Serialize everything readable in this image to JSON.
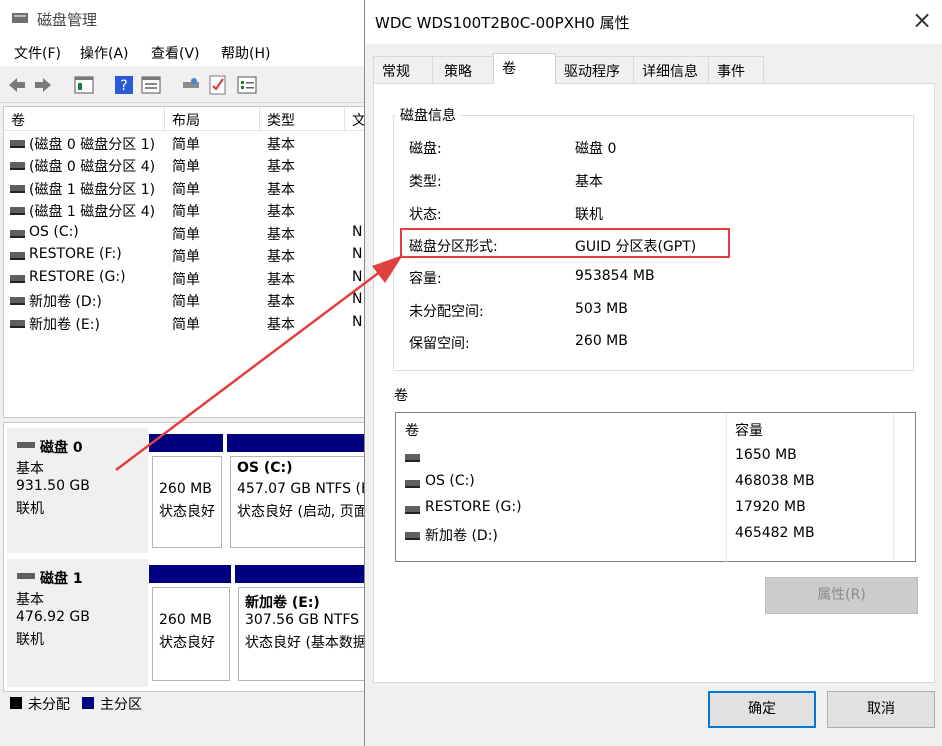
{
  "diskmgmt": {
    "title": "磁盘管理",
    "menu": [
      "文件(F)",
      "操作(A)",
      "查看(V)",
      "帮助(H)"
    ],
    "columns": [
      "卷",
      "布局",
      "类型",
      "文"
    ],
    "volumes": [
      {
        "name": "(磁盘 0 磁盘分区 1)",
        "layout": "简单",
        "type": "基本",
        "fs": ""
      },
      {
        "name": "(磁盘 0 磁盘分区 4)",
        "layout": "简单",
        "type": "基本",
        "fs": ""
      },
      {
        "name": "(磁盘 1 磁盘分区 1)",
        "layout": "简单",
        "type": "基本",
        "fs": ""
      },
      {
        "name": "(磁盘 1 磁盘分区 4)",
        "layout": "简单",
        "type": "基本",
        "fs": ""
      },
      {
        "name": "OS (C:)",
        "layout": "简单",
        "type": "基本",
        "fs": "N"
      },
      {
        "name": "RESTORE (F:)",
        "layout": "简单",
        "type": "基本",
        "fs": "N"
      },
      {
        "name": "RESTORE (G:)",
        "layout": "简单",
        "type": "基本",
        "fs": "N"
      },
      {
        "name": "新加卷 (D:)",
        "layout": "简单",
        "type": "基本",
        "fs": "N"
      },
      {
        "name": "新加卷 (E:)",
        "layout": "简单",
        "type": "基本",
        "fs": "N"
      }
    ],
    "disks": [
      {
        "name": "磁盘 0",
        "kind": "基本",
        "size": "931.50 GB",
        "status": "联机",
        "partitions": [
          {
            "title": "",
            "line1": "260 MB",
            "line2": "状态良好"
          },
          {
            "title": "OS  (C:)",
            "line1": "457.07 GB NTFS (B",
            "line2": "状态良好 (启动, 页面"
          }
        ]
      },
      {
        "name": "磁盘 1",
        "kind": "基本",
        "size": "476.92 GB",
        "status": "联机",
        "partitions": [
          {
            "title": "",
            "line1": "260 MB",
            "line2": "状态良好"
          },
          {
            "title": "新加卷  (E:)",
            "line1": "307.56 GB NTFS (",
            "line2": "状态良好 (基本数据"
          }
        ]
      }
    ],
    "legend": [
      {
        "label": "未分配",
        "color": "#000000"
      },
      {
        "label": "主分区",
        "color": "#000080"
      }
    ]
  },
  "dialog": {
    "title": "WDC WDS100T2B0C-00PXH0 属性",
    "tabs": [
      "常规",
      "策略",
      "卷",
      "驱动程序",
      "详细信息",
      "事件"
    ],
    "active_tab": "卷",
    "disk_info_caption": "磁盘信息",
    "disk_info": [
      {
        "key": "磁盘:",
        "value": "磁盘 0"
      },
      {
        "key": "类型:",
        "value": "基本"
      },
      {
        "key": "状态:",
        "value": "联机"
      },
      {
        "key": "磁盘分区形式:",
        "value": "GUID 分区表(GPT)"
      },
      {
        "key": "容量:",
        "value": "953854 MB"
      },
      {
        "key": "未分配空间:",
        "value": "503 MB"
      },
      {
        "key": "保留空间:",
        "value": "260 MB"
      }
    ],
    "volumes_caption": "卷",
    "volume_columns": [
      "卷",
      "容量"
    ],
    "volume_rows": [
      {
        "name": "",
        "capacity": "1650 MB"
      },
      {
        "name": "OS (C:)",
        "capacity": "468038 MB"
      },
      {
        "name": "RESTORE (G:)",
        "capacity": "17920 MB"
      },
      {
        "name": "新加卷 (D:)",
        "capacity": "465482 MB"
      }
    ],
    "properties_button": "属性(R)",
    "ok_button": "确定",
    "cancel_button": "取消"
  },
  "colors": {
    "highlight_box": "#e04040",
    "primary_partition": "#000080",
    "default_button_border": "#0078d7"
  }
}
